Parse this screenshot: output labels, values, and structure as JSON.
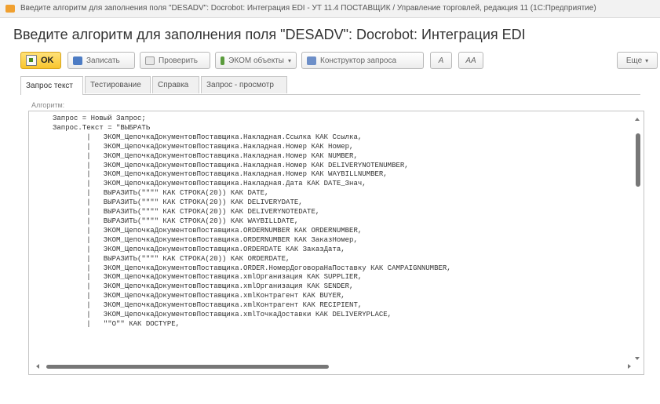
{
  "window": {
    "title": "Введите алгоритм для заполнения поля \"DESADV\": Docrobot: Интеграция EDI - УТ 11.4 ПОСТАВЩИК / Управление торговлей, редакция 11 (1С:Предприятие)"
  },
  "page": {
    "title": "Введите алгоритм для заполнения поля \"DESADV\": Docrobot: Интеграция EDI"
  },
  "toolbar": {
    "ok_label": "OK",
    "save_label": "Записать",
    "check_label": "Проверить",
    "objects_label": "ЭКОМ объекты",
    "query_builder_label": "Конструктор запроса",
    "a_label": "A",
    "aa_label": "AA",
    "more_label": "Еще"
  },
  "tabs": [
    {
      "label": "Запрос текст"
    },
    {
      "label": "Тестирование"
    },
    {
      "label": "Справка"
    },
    {
      "label": "Запрос - просмотр"
    }
  ],
  "editor": {
    "label": "Алгоритм:",
    "code": "Запрос = Новый Запрос;\nЗапрос.Текст = \"ВЫБРАТЬ\n        |   ЭКОМ_ЦепочкаДокументовПоставщика.Накладная.Ссылка КАК Ссылка,\n        |   ЭКОМ_ЦепочкаДокументовПоставщика.Накладная.Номер КАК Номер,\n        |   ЭКОМ_ЦепочкаДокументовПоставщика.Накладная.Номер КАК NUMBER,\n        |   ЭКОМ_ЦепочкаДокументовПоставщика.Накладная.Номер КАК DELIVERYNOTENUMBER,\n        |   ЭКОМ_ЦепочкаДокументовПоставщика.Накладная.Номер КАК WAYBILLNUMBER,\n        |   ЭКОМ_ЦепочкаДокументовПоставщика.Накладная.Дата КАК DATE_Знач,\n        |   ВЫРАЗИТЬ(\"\"\"\" КАК СТРОКА(20)) КАК DATE,\n        |   ВЫРАЗИТЬ(\"\"\"\" КАК СТРОКА(20)) КАК DELIVERYDATE,\n        |   ВЫРАЗИТЬ(\"\"\"\" КАК СТРОКА(20)) КАК DELIVERYNOTEDATE,\n        |   ВЫРАЗИТЬ(\"\"\"\" КАК СТРОКА(20)) КАК WAYBILLDATE,\n        |   ЭКОМ_ЦепочкаДокументовПоставщика.ORDERNUMBER КАК ORDERNUMBER,\n        |   ЭКОМ_ЦепочкаДокументовПоставщика.ORDERNUMBER КАК ЗаказНомер,\n        |   ЭКОМ_ЦепочкаДокументовПоставщика.ORDERDATE КАК ЗаказДата,\n        |   ВЫРАЗИТЬ(\"\"\"\" КАК СТРОКА(20)) КАК ORDERDATE,\n        |   ЭКОМ_ЦепочкаДокументовПоставщика.ORDER.НомерДоговораНаПоставку КАК CAMPAIGNNUMBER,\n        |   ЭКОМ_ЦепочкаДокументовПоставщика.xmlОрганизация КАК SUPPLIER,\n        |   ЭКОМ_ЦепочкаДокументовПоставщика.xmlОрганизация КАК SENDER,\n        |   ЭКОМ_ЦепочкаДокументовПоставщика.xmlКонтрагент КАК BUYER,\n        |   ЭКОМ_ЦепочкаДокументовПоставщика.xmlКонтрагент КАК RECIPIENT,\n        |   ЭКОМ_ЦепочкаДокументовПоставщика.xmlТочкаДоставки КАК DELIVERYPLACE,\n        |   \"\"O\"\" КАК DOCTYPE,"
  }
}
